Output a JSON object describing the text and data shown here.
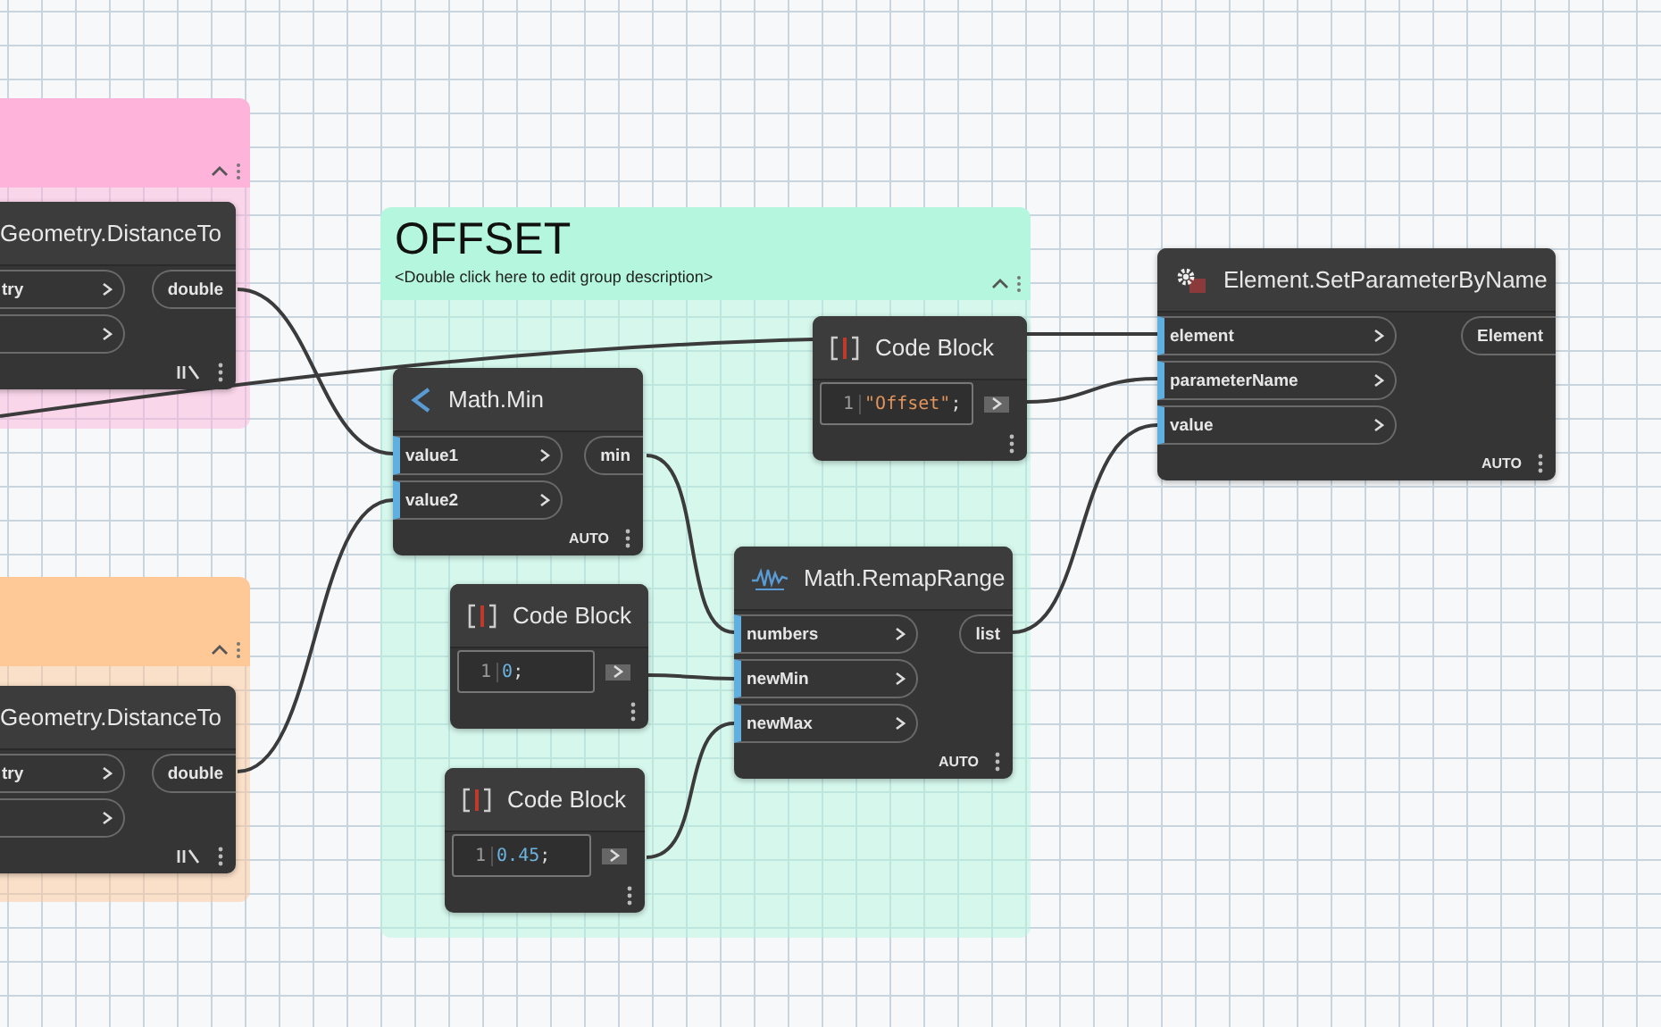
{
  "groups": [
    {
      "color": "#fdb3da"
    },
    {
      "color": "#ffc897"
    },
    {
      "title": "OFFSET",
      "description": "<Double click here to edit group description>",
      "color": "#b4f6de"
    }
  ],
  "nodes": [
    {
      "kind": "function",
      "title": "Geometry.DistanceTo",
      "inputs": [
        {
          "kind": "labeled",
          "label": "try"
        },
        {
          "kind": "blank"
        }
      ],
      "outputs": [
        {
          "label": "double"
        }
      ]
    },
    {
      "kind": "function",
      "title": "Geometry.DistanceTo",
      "inputs": [
        {
          "kind": "labeled",
          "label": "try"
        },
        {
          "kind": "blank"
        }
      ],
      "outputs": [
        {
          "label": "double"
        }
      ]
    },
    {
      "kind": "function",
      "title": "Math.Min",
      "inputs": [
        {
          "label": "value1",
          "connected": true
        },
        {
          "label": "value2",
          "connected": true
        }
      ],
      "outputs": [
        {
          "label": "min"
        }
      ],
      "lacing": "AUTO"
    },
    {
      "kind": "code_block",
      "title": "Code Block",
      "line_number": "1",
      "code": [
        {
          "text": "\"Offset\"",
          "color": "#e0935a"
        },
        {
          "text": ";",
          "color": "#dddddd"
        }
      ]
    },
    {
      "kind": "code_block",
      "title": "Code Block",
      "line_number": "1",
      "code": [
        {
          "text": "0",
          "color": "#6cb4e0"
        },
        {
          "text": ";",
          "color": "#dddddd"
        }
      ]
    },
    {
      "kind": "code_block",
      "title": "Code Block",
      "line_number": "1",
      "code": [
        {
          "text": "0.45",
          "color": "#6cb4e0"
        },
        {
          "text": ";",
          "color": "#dddddd"
        }
      ]
    },
    {
      "kind": "function",
      "title": "Math.RemapRange",
      "inputs": [
        {
          "label": "numbers",
          "connected": true
        },
        {
          "label": "newMin",
          "connected": true
        },
        {
          "label": "newMax",
          "connected": true
        }
      ],
      "outputs": [
        {
          "label": "list"
        }
      ],
      "lacing": "AUTO"
    },
    {
      "kind": "function",
      "title": "Element.SetParameterByName",
      "inputs": [
        {
          "label": "element",
          "connected": true
        },
        {
          "label": "parameterName",
          "connected": true
        },
        {
          "label": "value",
          "connected": true
        }
      ],
      "outputs": [
        {
          "label": "Element"
        }
      ],
      "lacing": "AUTO"
    }
  ]
}
